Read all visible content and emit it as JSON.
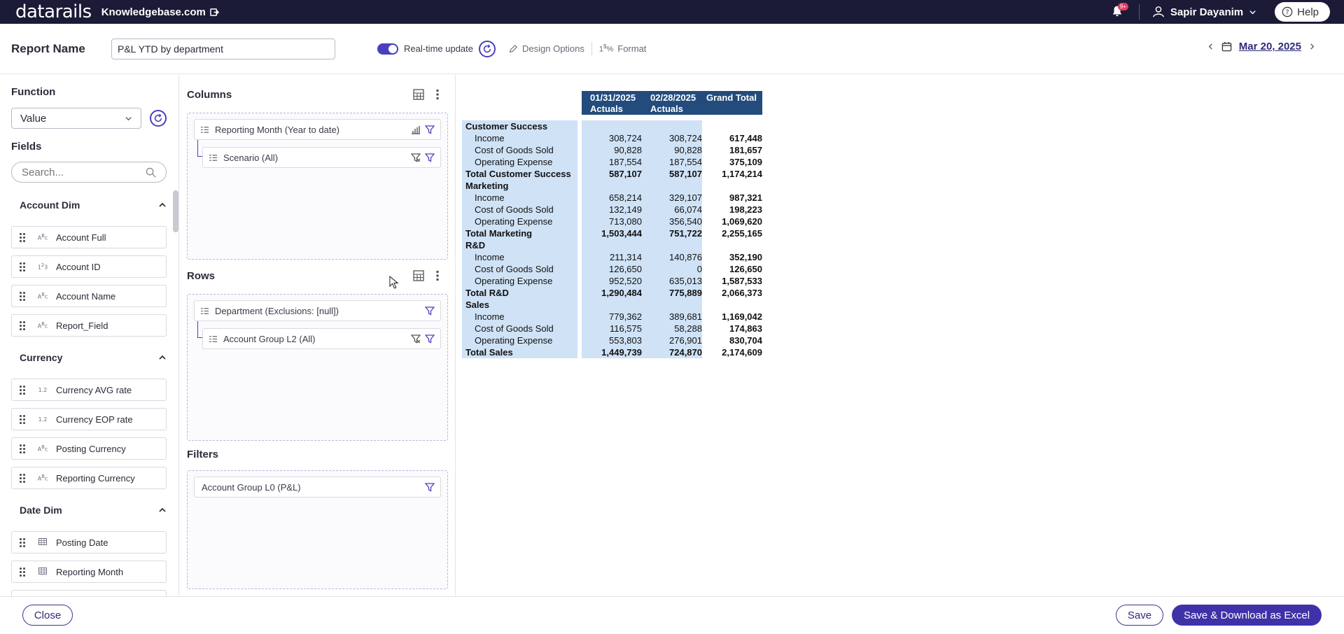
{
  "topbar": {
    "logo": "datarails",
    "site": "Knowledgebase.com",
    "notification_badge": "9+",
    "user_name": "Sapir Dayanim",
    "help_label": "Help"
  },
  "header": {
    "report_name_label": "Report Name",
    "report_name_value": "P&L YTD by department",
    "realtime_label": "Real-time update",
    "design_options_label": "Design Options",
    "format_label": "Format",
    "date": "Mar 20, 2025"
  },
  "left": {
    "function_label": "Function",
    "function_value": "Value",
    "fields_label": "Fields",
    "search_placeholder": "Search...",
    "groups": [
      {
        "name": "Account Dim",
        "fields": [
          {
            "type": "ABC",
            "name": "Account Full"
          },
          {
            "type": "123",
            "name": "Account ID"
          },
          {
            "type": "ABC",
            "name": "Account Name"
          },
          {
            "type": "ABC",
            "name": "Report_Field"
          }
        ]
      },
      {
        "name": "Currency",
        "fields": [
          {
            "type": "1.2",
            "name": "Currency AVG rate"
          },
          {
            "type": "1.2",
            "name": "Currency EOP rate"
          },
          {
            "type": "ABC",
            "name": "Posting Currency"
          },
          {
            "type": "ABC",
            "name": "Reporting Currency"
          }
        ]
      },
      {
        "name": "Date Dim",
        "fields": [
          {
            "type": "grid",
            "name": "Posting Date"
          },
          {
            "type": "grid",
            "name": "Reporting Month"
          }
        ]
      }
    ]
  },
  "config": {
    "columns_label": "Columns",
    "columns": [
      "Reporting Month (Year to date)",
      "Scenario (All)"
    ],
    "rows_label": "Rows",
    "rows": [
      "Department (Exclusions: [null])",
      "Account Group L2 (All)"
    ],
    "filters_label": "Filters",
    "filters": [
      "Account Group L0 (P&L)"
    ]
  },
  "pivot": {
    "headers": [
      {
        "line1": "01/31/2025",
        "line2": "Actuals"
      },
      {
        "line1": "02/28/2025",
        "line2": "Actuals"
      },
      {
        "line1": "Grand Total",
        "line2": ""
      }
    ],
    "rows": [
      {
        "label": "Customer Success",
        "kind": "group",
        "a": "",
        "b": "",
        "t": ""
      },
      {
        "label": "Income",
        "kind": "item",
        "a": "308,724",
        "b": "308,724",
        "t": "617,448"
      },
      {
        "label": "Cost of Goods Sold",
        "kind": "item",
        "a": "90,828",
        "b": "90,828",
        "t": "181,657"
      },
      {
        "label": "Operating Expense",
        "kind": "item",
        "a": "187,554",
        "b": "187,554",
        "t": "375,109"
      },
      {
        "label": "Total Customer Success",
        "kind": "total",
        "a": "587,107",
        "b": "587,107",
        "t": "1,174,214"
      },
      {
        "label": "Marketing",
        "kind": "group",
        "a": "",
        "b": "",
        "t": ""
      },
      {
        "label": "Income",
        "kind": "item",
        "a": "658,214",
        "b": "329,107",
        "t": "987,321"
      },
      {
        "label": "Cost of Goods Sold",
        "kind": "item",
        "a": "132,149",
        "b": "66,074",
        "t": "198,223"
      },
      {
        "label": "Operating Expense",
        "kind": "item",
        "a": "713,080",
        "b": "356,540",
        "t": "1,069,620"
      },
      {
        "label": "Total Marketing",
        "kind": "total",
        "a": "1,503,444",
        "b": "751,722",
        "t": "2,255,165"
      },
      {
        "label": "R&D",
        "kind": "group",
        "a": "",
        "b": "",
        "t": ""
      },
      {
        "label": "Income",
        "kind": "item",
        "a": "211,314",
        "b": "140,876",
        "t": "352,190"
      },
      {
        "label": "Cost of Goods Sold",
        "kind": "item",
        "a": "126,650",
        "b": "0",
        "t": "126,650"
      },
      {
        "label": "Operating Expense",
        "kind": "item",
        "a": "952,520",
        "b": "635,013",
        "t": "1,587,533"
      },
      {
        "label": "Total R&D",
        "kind": "total",
        "a": "1,290,484",
        "b": "775,889",
        "t": "2,066,373"
      },
      {
        "label": "Sales",
        "kind": "group",
        "a": "",
        "b": "",
        "t": ""
      },
      {
        "label": "Income",
        "kind": "item",
        "a": "779,362",
        "b": "389,681",
        "t": "1,169,042"
      },
      {
        "label": "Cost of Goods Sold",
        "kind": "item",
        "a": "116,575",
        "b": "58,288",
        "t": "174,863"
      },
      {
        "label": "Operating Expense",
        "kind": "item",
        "a": "553,803",
        "b": "276,901",
        "t": "830,704"
      },
      {
        "label": "Total Sales",
        "kind": "total",
        "a": "1,449,739",
        "b": "724,870",
        "t": "2,174,609"
      }
    ]
  },
  "footer": {
    "close_label": "Close",
    "save_label": "Save",
    "save_download_label": "Save & Download as Excel"
  },
  "colors": {
    "topbar": "#1b1a37",
    "accent": "#3f32a8",
    "pivot_header": "#234c7c",
    "pivot_cell": "#cfe2f6"
  }
}
